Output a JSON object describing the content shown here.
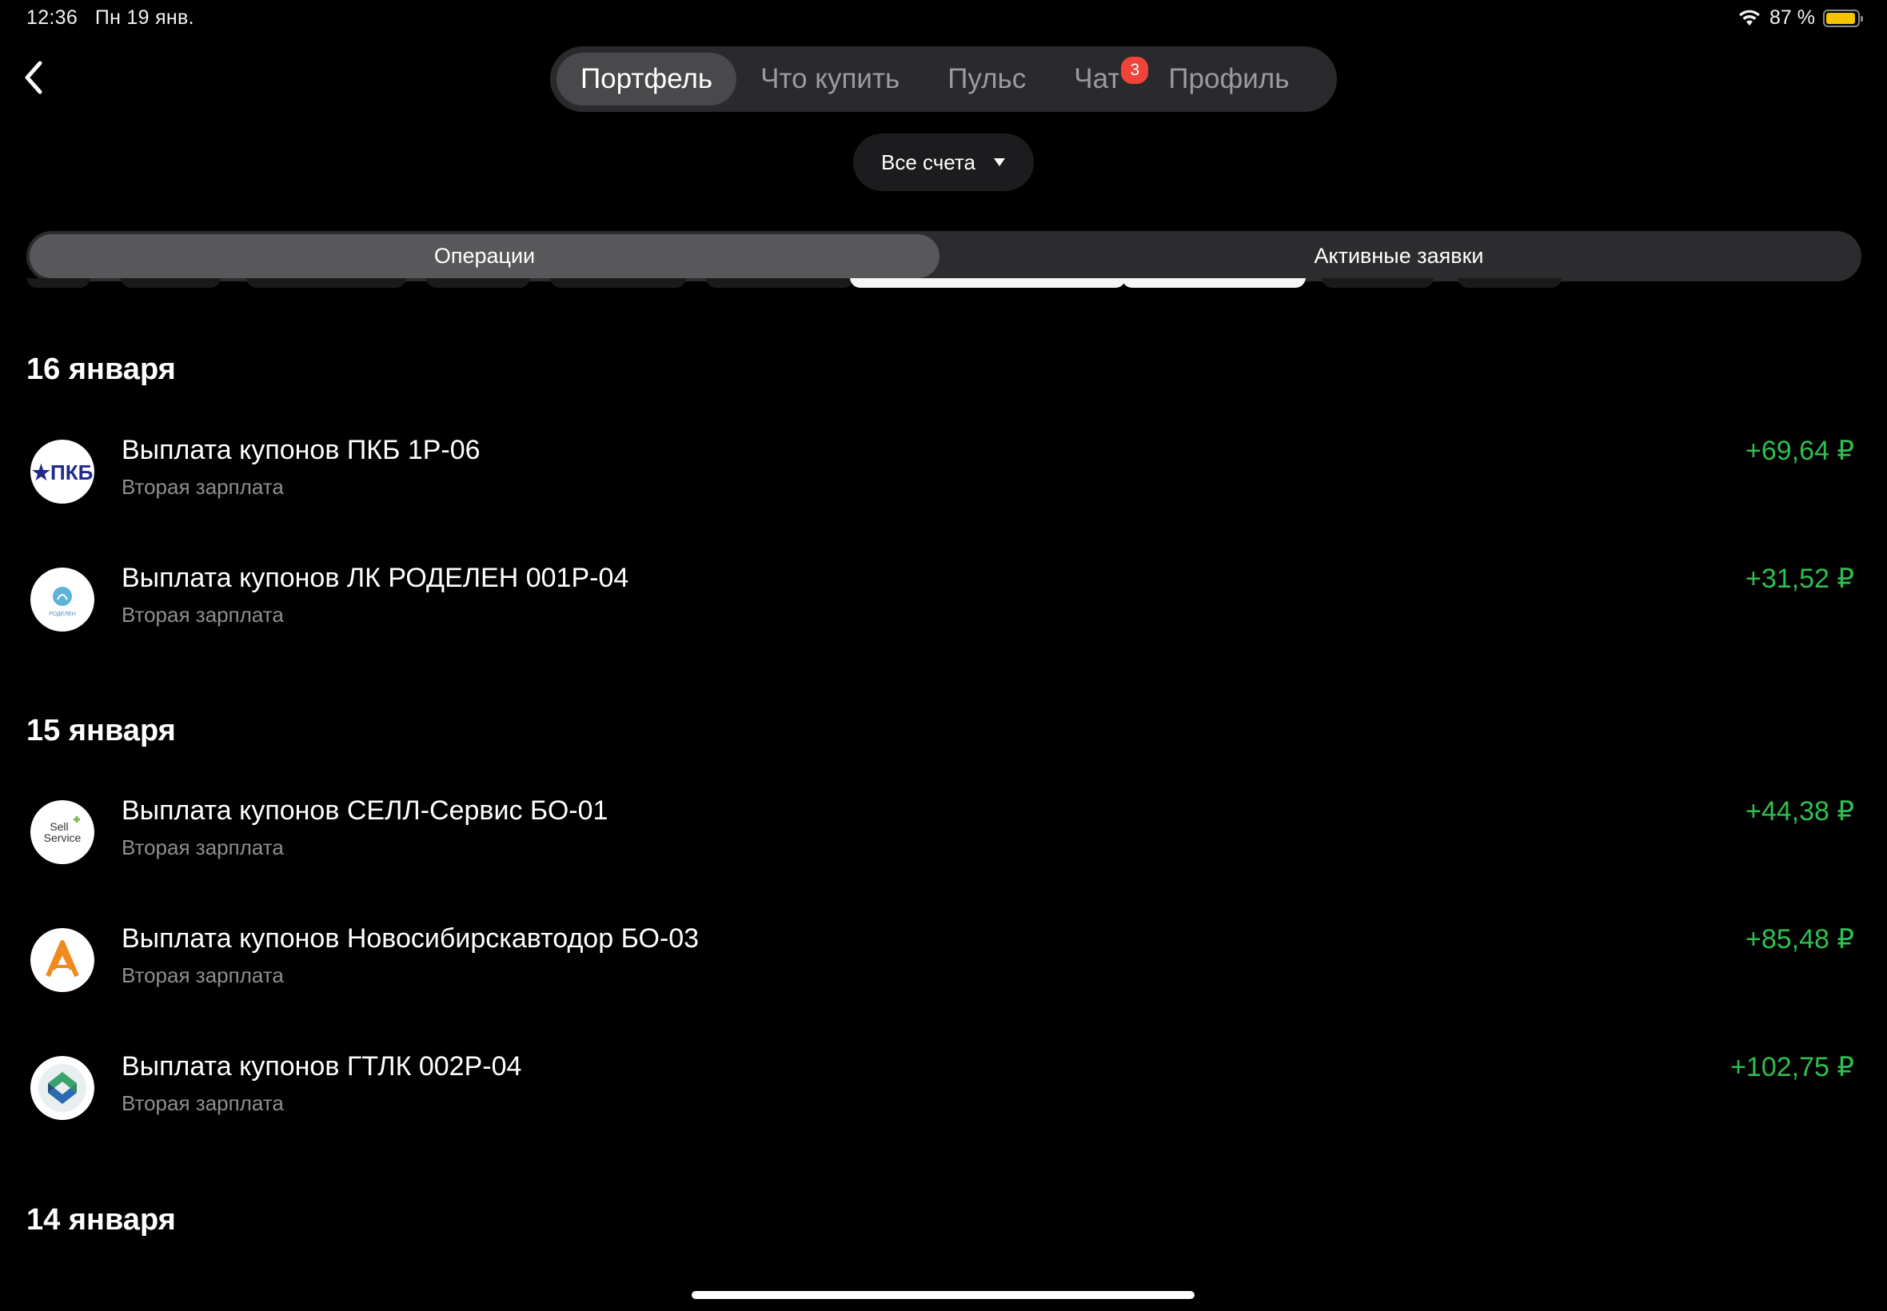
{
  "status": {
    "time": "12:36",
    "date": "Пн 19 янв.",
    "battery": "87 %"
  },
  "nav": {
    "tabs": [
      "Портфель",
      "Что купить",
      "Пульс",
      "Чат",
      "Профиль"
    ],
    "active": "Портфель",
    "chat_badge": "3"
  },
  "accounts": {
    "label": "Все счета"
  },
  "segments": {
    "operations": "Операции",
    "active_orders": "Активные заявки"
  },
  "groups": [
    {
      "date": "16 января",
      "items": [
        {
          "title": "Выплата купонов ПКБ 1Р-06",
          "account": "Вторая зарплата",
          "amount": "+69,64 ₽",
          "logo": "pkb-logo",
          "logo_text": "★ПКБ"
        },
        {
          "title": "Выплата купонов ЛК РОДЕЛЕН 001Р-04",
          "account": "Вторая зарплата",
          "amount": "+31,52 ₽",
          "logo": "rodelen-logo",
          "logo_text": "РОДЕЛЕН"
        }
      ]
    },
    {
      "date": "15 января",
      "items": [
        {
          "title": "Выплата купонов СЕЛЛ-Сервис БО-01",
          "account": "Вторая зарплата",
          "amount": "+44,38 ₽",
          "logo": "sell-service-logo",
          "logo_text": "Sell Service"
        },
        {
          "title": "Выплата купонов Новосибирскавтодор БО-03",
          "account": "Вторая зарплата",
          "amount": "+85,48 ₽",
          "logo": "novosibirskavtodor-logo"
        },
        {
          "title": "Выплата купонов ГТЛК 002Р-04",
          "account": "Вторая зарплата",
          "amount": "+102,75 ₽",
          "logo": "gtlk-logo"
        }
      ]
    },
    {
      "date": "14 января",
      "items": []
    }
  ],
  "colors": {
    "positive": "#2fbf4f",
    "badge": "#f0433a",
    "background": "#000000"
  }
}
